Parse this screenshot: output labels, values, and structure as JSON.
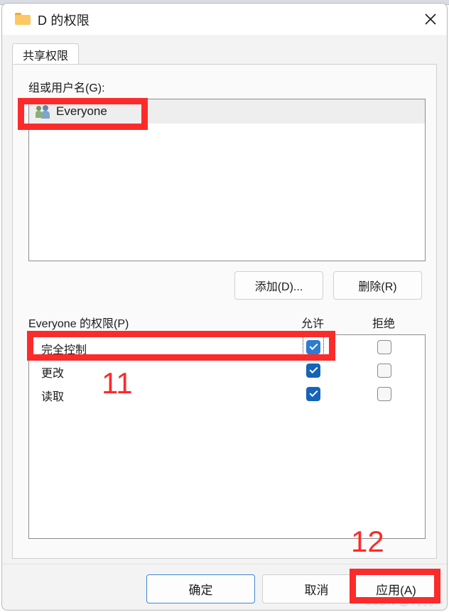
{
  "window": {
    "title": "D 的权限",
    "folder_icon": "folder-icon",
    "close_label": "✕"
  },
  "tabs": [
    {
      "label": "共享权限",
      "selected": true
    }
  ],
  "groups_section": {
    "label": "组或用户名(G):",
    "items": [
      {
        "name": "Everyone",
        "icon": "users-group-icon",
        "selected": true
      }
    ],
    "buttons": {
      "add": "添加(D)...",
      "remove": "删除(R)"
    }
  },
  "permissions_section": {
    "label": "Everyone 的权限(P)",
    "columns": [
      "允许",
      "拒绝"
    ],
    "rows": [
      {
        "name": "完全控制",
        "allow": true,
        "deny": false,
        "focused": true
      },
      {
        "name": "更改",
        "allow": true,
        "deny": false,
        "focused": false
      },
      {
        "name": "读取",
        "allow": true,
        "deny": false,
        "focused": false
      }
    ]
  },
  "footer": {
    "ok": "确定",
    "cancel": "取消",
    "apply": "应用(A)"
  },
  "annotations": {
    "step_11": "11",
    "step_12": "12",
    "color": "#fc2b2b"
  },
  "watermark": "CSDN @Y。。。"
}
